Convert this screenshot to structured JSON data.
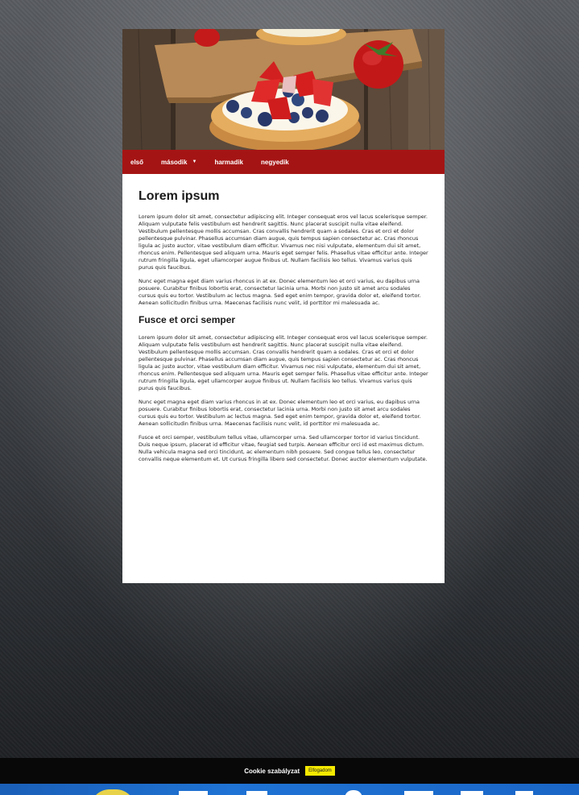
{
  "nav": {
    "items": [
      {
        "label": "első"
      },
      {
        "label": "második",
        "has_submenu": true
      },
      {
        "label": "harmadik"
      },
      {
        "label": "negyedik"
      }
    ]
  },
  "article": {
    "heading": "Lorem ipsum",
    "paragraphs_1": [
      "Lorem ipsum dolor sit amet, consectetur adipiscing elit. Integer consequat eros vel lacus scelerisque semper. Aliquam vulputate felis vestibulum est hendrerit sagittis. Nunc placerat suscipit nulla vitae eleifend. Vestibulum pellentesque mollis accumsan. Cras convallis hendrerit quam a sodales. Cras et orci et dolor pellentesque pulvinar. Phasellus accumsan diam augue, quis tempus sapien consectetur ac. Cras rhoncus ligula ac justo auctor, vitae vestibulum diam efficitur. Vivamus nec nisi vulputate, elementum dui sit amet, rhoncus enim. Pellentesque sed aliquam urna. Mauris eget semper felis. Phasellus vitae efficitur ante. Integer rutrum fringilla ligula, eget ullamcorper augue finibus ut. Nullam facilisis leo tellus. Vivamus varius quis purus quis faucibus.",
      "Nunc eget magna eget diam varius rhoncus in at ex. Donec elementum leo et orci varius, eu dapibus urna posuere. Curabitur finibus lobortis erat, consectetur lacinia urna. Morbi non justo sit amet arcu sodales cursus quis eu tortor. Vestibulum ac lectus magna. Sed eget enim tempor, gravida dolor et, eleifend tortor. Aenean sollicitudin finibus urna. Maecenas facilisis nunc velit, id porttitor mi malesuada ac."
    ],
    "subheading": "Fusce et orci semper",
    "paragraphs_2": [
      "Lorem ipsum dolor sit amet, consectetur adipiscing elit. Integer consequat eros vel lacus scelerisque semper. Aliquam vulputate felis vestibulum est hendrerit sagittis. Nunc placerat suscipit nulla vitae eleifend. Vestibulum pellentesque mollis accumsan. Cras convallis hendrerit quam a sodales. Cras et orci et dolor pellentesque pulvinar. Phasellus accumsan diam augue, quis tempus sapien consectetur ac. Cras rhoncus ligula ac justo auctor, vitae vestibulum diam efficitur. Vivamus nec nisi vulputate, elementum dui sit amet, rhoncus enim. Pellentesque sed aliquam urna. Mauris eget semper felis. Phasellus vitae efficitur ante. Integer rutrum fringilla ligula, eget ullamcorper augue finibus ut. Nullam facilisis leo tellus. Vivamus varius quis purus quis faucibus.",
      "Nunc eget magna eget diam varius rhoncus in at ex. Donec elementum leo et orci varius, eu dapibus urna posuere. Curabitur finibus lobortis erat, consectetur lacinia urna. Morbi non justo sit amet arcu sodales cursus quis eu tortor. Vestibulum ac lectus magna. Sed eget enim tempor, gravida dolor et, eleifend tortor. Aenean sollicitudin finibus urna. Maecenas facilisis nunc velit, id porttitor mi malesuada ac.",
      "Fusce et orci semper, vestibulum tellus vitae, ullamcorper urna. Sed ullamcorper tortor id varius tincidunt. Duis neque ipsum, placerat id efficitur vitae, feugiat sed turpis. Aenean efficitur orci id est maximus dictum. Nulla vehicula magna sed orci tincidunt, ac elementum nibh posuere. Sed congue tellus leo, consectetur convallis neque elementum et. Ut cursus fringilla libero sed consectetur. Donec auctor elementum vulputate."
    ]
  },
  "cookie_bar": {
    "text": "Cookie szabályzat",
    "accept_label": "Elfogadom"
  },
  "colors": {
    "nav_bg": "#a51414",
    "cookie_button": "#f5e900",
    "taskbar": "#1f73d4"
  }
}
